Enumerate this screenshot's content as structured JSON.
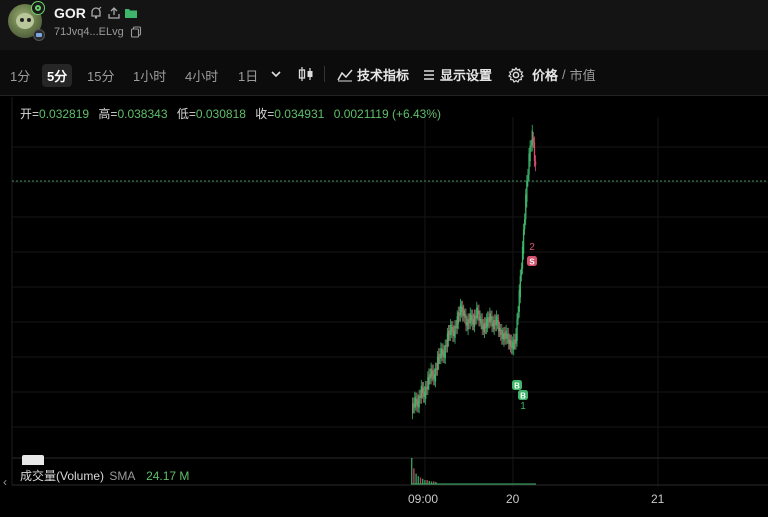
{
  "token": {
    "name": "GOR",
    "address": "71Jvq4...ELvg"
  },
  "timeframes": [
    "1分",
    "5分",
    "15分",
    "1小时",
    "4小时",
    "1日"
  ],
  "active_timeframe": "5分",
  "toolbar": {
    "indicators": "技术指标",
    "display": "显示设置",
    "price": "价格",
    "separator": "/",
    "market_cap": "市值"
  },
  "ohlc": {
    "open_label": "开=",
    "open": "0.032819",
    "high_label": "高=",
    "high": "0.038343",
    "low_label": "低=",
    "low": "0.030818",
    "close_label": "收=",
    "close": "0.034931",
    "change": "0.0021119 (+6.43%)"
  },
  "volume": {
    "label": "成交量(Volume)",
    "sma_label": "SMA",
    "value": "24.17 M"
  },
  "x_axis": {
    "ticks": [
      "09:00",
      "20",
      "21"
    ]
  },
  "markers": [
    {
      "type": "S",
      "label": "2"
    },
    {
      "type": "B",
      "label": ""
    },
    {
      "type": "B",
      "label": "1"
    }
  ],
  "colors": {
    "up": "#3fb56b",
    "down": "#d6516b",
    "buy": "#3fb56b",
    "sell": "#d6516b"
  },
  "chart_data": {
    "type": "line",
    "title": "",
    "xlabel": "",
    "ylabel": "",
    "y_high": 0.038343,
    "y_low": 0.030818,
    "last_price": 0.034931,
    "price_path_relative": [
      0.05,
      0.08,
      0.07,
      0.12,
      0.1,
      0.15,
      0.18,
      0.16,
      0.22,
      0.25,
      0.24,
      0.3,
      0.33,
      0.31,
      0.36,
      0.4,
      0.38,
      0.34,
      0.37,
      0.35,
      0.39,
      0.36,
      0.33,
      0.35,
      0.37,
      0.34,
      0.36,
      0.32,
      0.3,
      0.31,
      0.28,
      0.27,
      0.3,
      0.45,
      0.6,
      0.78,
      0.92,
      1.0,
      0.88
    ],
    "volume_relative": [
      1.0,
      0.6,
      0.4,
      0.3,
      0.25,
      0.2,
      0.15,
      0.15,
      0.12,
      0.1,
      0.1,
      0.08
    ]
  }
}
